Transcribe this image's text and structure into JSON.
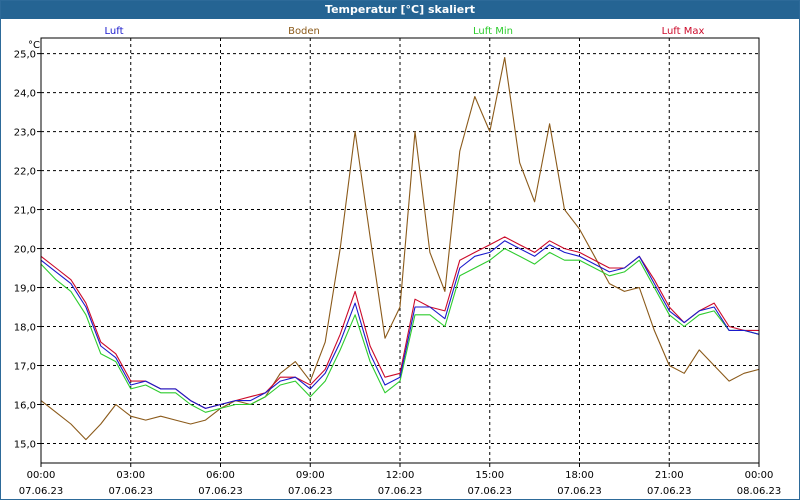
{
  "window": {
    "title": "Temperatur [°C] skaliert"
  },
  "chart_data": {
    "type": "line",
    "ylabel": "°C",
    "ylim": [
      14.5,
      25.4
    ],
    "yticks": [
      15.0,
      16.0,
      17.0,
      18.0,
      19.0,
      20.0,
      21.0,
      22.0,
      23.0,
      24.0,
      25.0
    ],
    "xlim": [
      "07.06.23 00:00",
      "08.06.23 00:00"
    ],
    "xticks": [
      {
        "time": "00:00",
        "date": "07.06.23"
      },
      {
        "time": "03:00",
        "date": "07.06.23"
      },
      {
        "time": "06:00",
        "date": "07.06.23"
      },
      {
        "time": "09:00",
        "date": "07.06.23"
      },
      {
        "time": "12:00",
        "date": "07.06.23"
      },
      {
        "time": "15:00",
        "date": "07.06.23"
      },
      {
        "time": "18:00",
        "date": "07.06.23"
      },
      {
        "time": "21:00",
        "date": "07.06.23"
      },
      {
        "time": "00:00",
        "date": "08.06.23"
      }
    ],
    "grid": true,
    "legend_position": "top",
    "x": [
      "00:00",
      "00:30",
      "01:00",
      "01:30",
      "02:00",
      "02:30",
      "03:00",
      "03:30",
      "04:00",
      "04:30",
      "05:00",
      "05:30",
      "06:00",
      "06:30",
      "07:00",
      "07:30",
      "08:00",
      "08:30",
      "09:00",
      "09:30",
      "10:00",
      "10:30",
      "11:00",
      "11:30",
      "12:00",
      "12:30",
      "13:00",
      "13:30",
      "14:00",
      "14:30",
      "15:00",
      "15:30",
      "16:00",
      "16:30",
      "17:00",
      "17:30",
      "18:00",
      "18:30",
      "19:00",
      "19:30",
      "20:00",
      "20:30",
      "21:00",
      "21:30",
      "22:00",
      "22:30",
      "23:00",
      "23:30",
      "00:00"
    ],
    "series": [
      {
        "name": "Luft",
        "color": "#1a1acc",
        "values": [
          19.7,
          19.4,
          19.1,
          18.5,
          17.5,
          17.2,
          16.5,
          16.6,
          16.4,
          16.4,
          16.1,
          15.9,
          16.0,
          16.1,
          16.1,
          16.3,
          16.6,
          16.7,
          16.4,
          16.8,
          17.6,
          18.6,
          17.3,
          16.5,
          16.7,
          18.5,
          18.5,
          18.2,
          19.5,
          19.8,
          19.9,
          20.2,
          20.0,
          19.8,
          20.1,
          19.9,
          19.8,
          19.6,
          19.4,
          19.5,
          19.8,
          19.1,
          18.4,
          18.1,
          18.4,
          18.5,
          17.9,
          17.9,
          17.8
        ]
      },
      {
        "name": "Boden",
        "color": "#8b5a1a",
        "values": [
          16.1,
          15.8,
          15.5,
          15.1,
          15.5,
          16.0,
          15.7,
          15.6,
          15.7,
          15.6,
          15.5,
          15.6,
          15.9,
          16.1,
          16.0,
          16.2,
          16.8,
          17.1,
          16.6,
          17.6,
          20.0,
          23.0,
          20.3,
          17.7,
          18.5,
          23.0,
          19.9,
          18.9,
          22.5,
          23.9,
          23.0,
          24.9,
          22.2,
          21.2,
          23.2,
          21.0,
          20.5,
          19.8,
          19.1,
          18.9,
          19.0,
          17.9,
          17.0,
          16.8,
          17.4,
          17.0,
          16.6,
          16.8,
          16.9
        ]
      },
      {
        "name": "Luft Min",
        "color": "#2ecc2e",
        "values": [
          19.6,
          19.2,
          18.9,
          18.3,
          17.3,
          17.1,
          16.4,
          16.5,
          16.3,
          16.3,
          16.0,
          15.8,
          15.9,
          16.0,
          16.0,
          16.2,
          16.5,
          16.6,
          16.2,
          16.6,
          17.4,
          18.3,
          17.1,
          16.3,
          16.6,
          18.3,
          18.3,
          18.0,
          19.3,
          19.5,
          19.7,
          20.0,
          19.8,
          19.6,
          19.9,
          19.7,
          19.7,
          19.5,
          19.3,
          19.4,
          19.7,
          19.0,
          18.3,
          18.0,
          18.3,
          18.4,
          17.9,
          17.9,
          17.8
        ]
      },
      {
        "name": "Luft Max",
        "color": "#cc0a2a",
        "values": [
          19.8,
          19.5,
          19.2,
          18.6,
          17.6,
          17.3,
          16.6,
          16.6,
          16.4,
          16.4,
          16.1,
          15.9,
          16.0,
          16.1,
          16.2,
          16.3,
          16.7,
          16.7,
          16.5,
          16.9,
          17.8,
          18.9,
          17.5,
          16.7,
          16.8,
          18.7,
          18.5,
          18.4,
          19.7,
          19.9,
          20.1,
          20.3,
          20.1,
          19.9,
          20.2,
          20.0,
          19.9,
          19.7,
          19.5,
          19.5,
          19.8,
          19.2,
          18.5,
          18.1,
          18.4,
          18.6,
          18.0,
          17.9,
          17.9
        ]
      }
    ]
  }
}
